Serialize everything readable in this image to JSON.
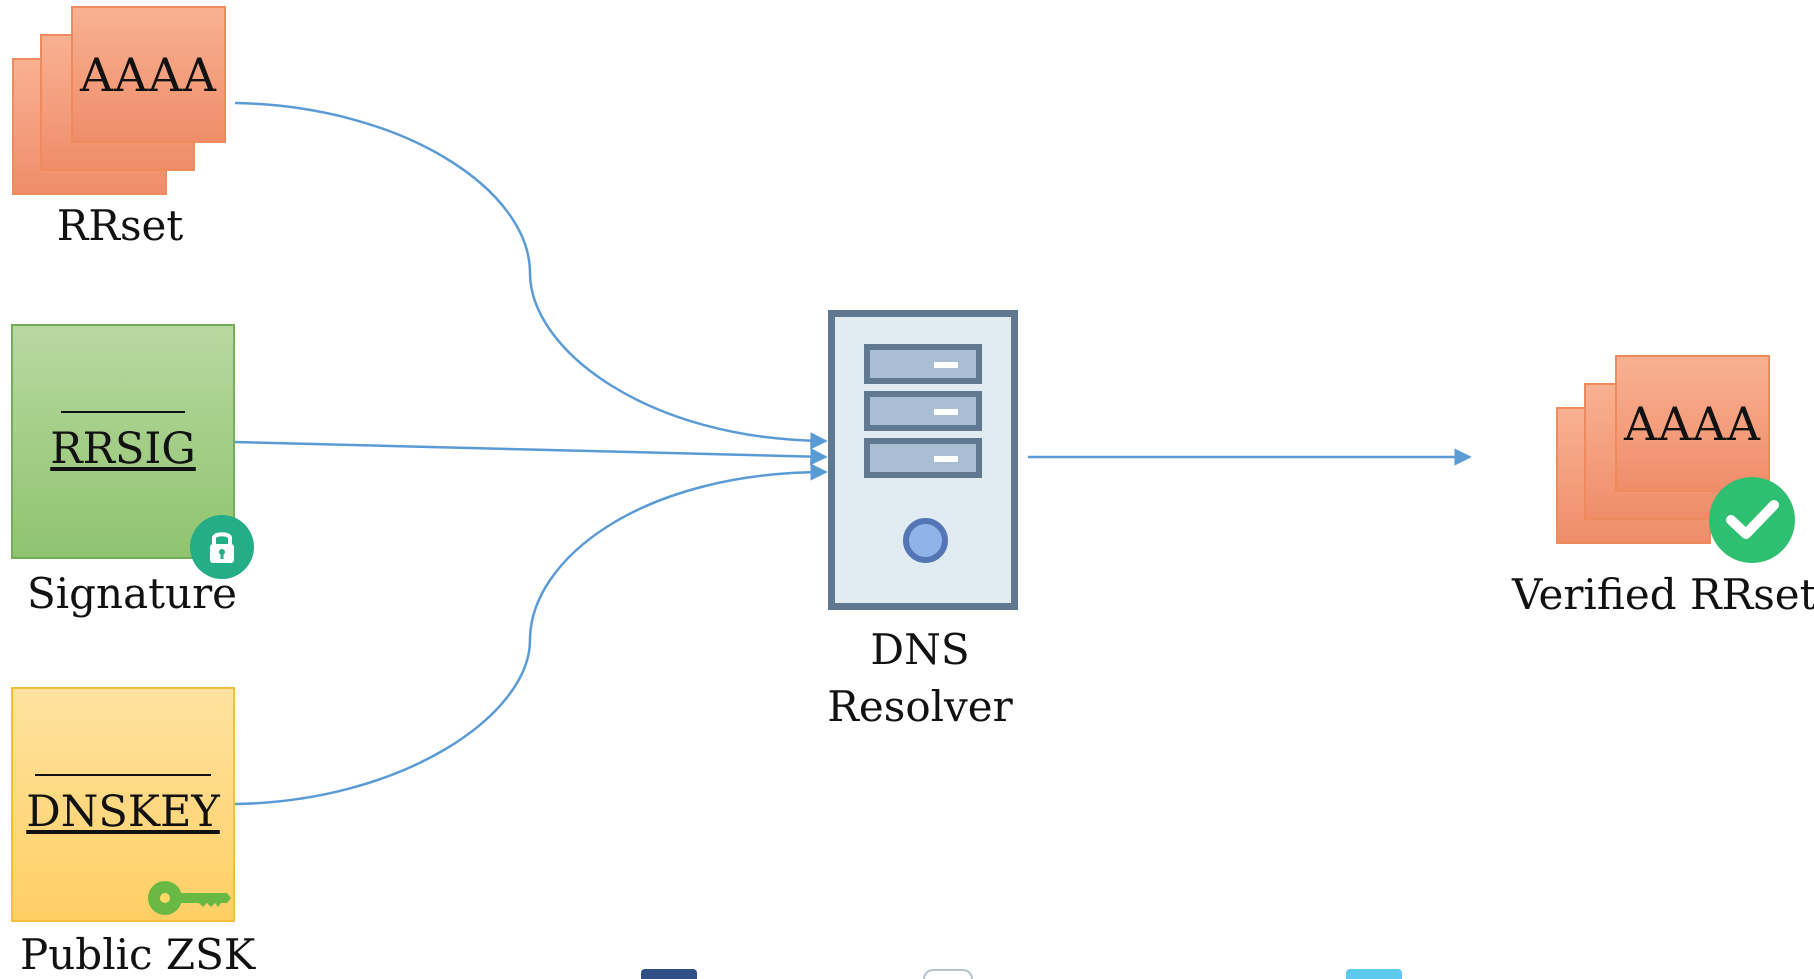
{
  "diagram": {
    "rrset_input": {
      "record": "AAAA",
      "label": "RRset"
    },
    "signature": {
      "record": "RRSIG",
      "label": "Signature",
      "icon": "lock-icon"
    },
    "public_key": {
      "record": "DNSKEY",
      "label": "Public ZSK",
      "icon": "key-icon"
    },
    "resolver": {
      "line1": "DNS",
      "line2": "Resolver",
      "icon": "server-icon"
    },
    "verified": {
      "record": "AAAA",
      "label": "Verified RRset",
      "icon": "check-circle-icon"
    }
  },
  "colors": {
    "connector": "#5b9bd5",
    "rrset_fill": "#f4a07b",
    "signature_fill": "#a9d08e",
    "key_fill": "#ffd966",
    "badge_green": "#24ad87",
    "check_green": "#2fbf71",
    "server_stroke": "#617891"
  }
}
